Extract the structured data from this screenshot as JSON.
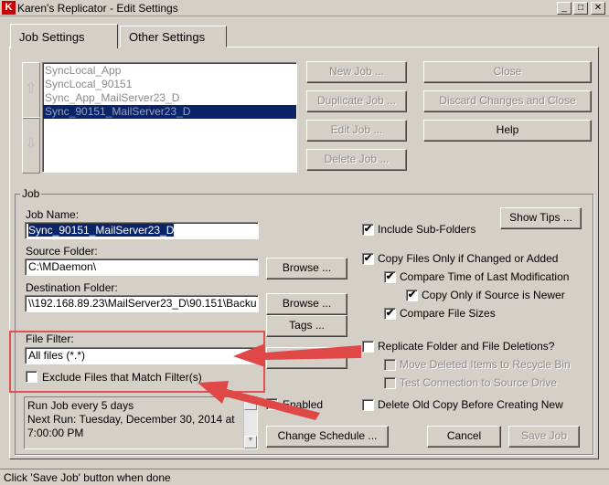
{
  "window": {
    "app_icon": "K",
    "title": "Karen's Replicator - Edit Settings",
    "controls": [
      "_",
      "□",
      "✕"
    ]
  },
  "tabs": [
    {
      "label": "Job Settings"
    },
    {
      "label": "Other Settings"
    }
  ],
  "job_list": {
    "items": [
      "SyncLocal_App",
      "SyncLocal_90151",
      "Sync_App_MailServer23_D",
      "Sync_90151_MailServer23_D"
    ],
    "selected": "Sync_90151_MailServer23_D",
    "up_icon": "⇧",
    "down_icon": "⇩"
  },
  "buttons": {
    "new_job": "New Job ...",
    "duplicate_job": "Duplicate Job ...",
    "edit_job": "Edit Job ...",
    "delete_job": "Delete Job ...",
    "close": "Close",
    "discard": "Discard Changes and Close",
    "help": "Help",
    "show_tips": "Show Tips ...",
    "browse_source": "Browse ...",
    "browse_dest": "Browse ...",
    "tags": "Tags ...",
    "change_schedule": "Change Schedule ...",
    "cancel": "Cancel",
    "save_job": "Save Job"
  },
  "job": {
    "group_label": "Job",
    "name_label": "Job Name:",
    "name_value": "Sync_90151_MailServer23_D",
    "source_label": "Source Folder:",
    "source_value": "C:\\MDaemon\\",
    "dest_label": "Destination Folder:",
    "dest_value": "\\\\192.168.89.23\\MailServer23_D\\90.151\\Backu",
    "filter_label": "File Filter:",
    "filter_value": "All files (*.*)",
    "exclude_label": "Exclude Files that Match Filter(s)",
    "schedule_lines": [
      "Run Job every 5 days",
      "Next Run: Tuesday, December 30, 2014 at",
      "7:00:00 PM"
    ],
    "enabled_label": "Enabled"
  },
  "options": {
    "include_sub": {
      "label": "Include Sub-Folders",
      "checked": true
    },
    "copy_changed": {
      "label": "Copy Files Only if Changed or Added",
      "checked": true
    },
    "compare_time": {
      "label": "Compare Time of Last Modification",
      "checked": true
    },
    "copy_newer": {
      "label": "Copy Only if Source is Newer",
      "checked": true
    },
    "compare_size": {
      "label": "Compare File Sizes",
      "checked": true
    },
    "replicate": {
      "label": "Replicate Folder and File Deletions?",
      "checked": false
    },
    "move_deleted": {
      "label": "Move Deleted Items to Recycle Bin",
      "checked": false
    },
    "test_conn": {
      "label": "Test Connection to Source Drive",
      "checked": false
    },
    "delete_old": {
      "label": "Delete Old Copy Before Creating New",
      "checked": false
    }
  },
  "status": "Click 'Save Job' button when done",
  "annotation_color": "#e04848"
}
